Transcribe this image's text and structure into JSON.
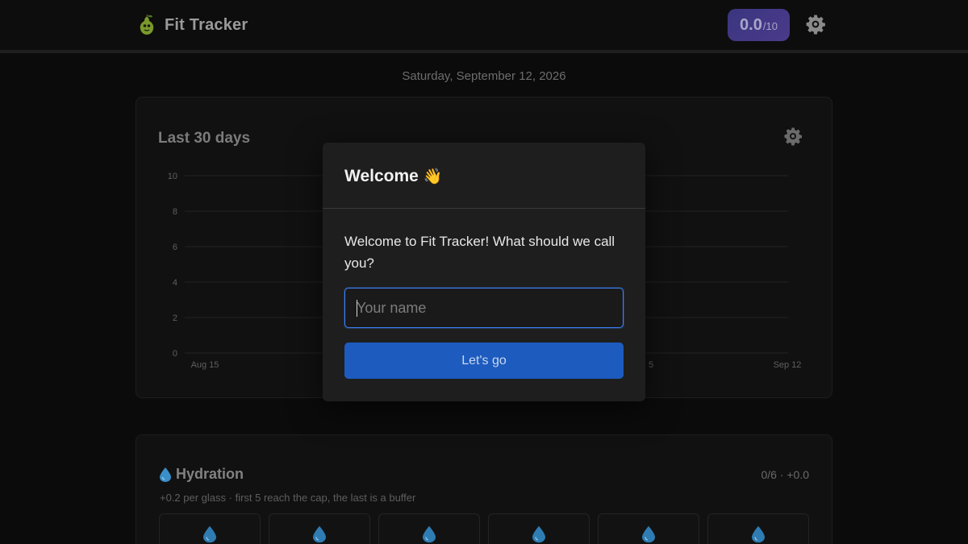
{
  "app": {
    "title": "Fit Tracker",
    "score": {
      "value": "0.0",
      "max": "/10"
    },
    "icons": {
      "logo": "pear-logo-icon",
      "settings": "gear-icon"
    }
  },
  "date": "Saturday, September 12, 2026",
  "chart_card": {
    "title": "Last 30 days",
    "settings_icon": "gear-icon"
  },
  "chart_data": {
    "type": "line",
    "title": "Last 30 days",
    "xlabel": "",
    "ylabel": "",
    "x_tick_labels": [
      "Aug 15",
      "5",
      "Sep 12"
    ],
    "y_ticks": [
      0,
      2,
      4,
      6,
      8,
      10
    ],
    "ylim": [
      0,
      10
    ],
    "grid": true,
    "series": []
  },
  "hydration": {
    "icon": "water-drop-icon",
    "title": "Hydration",
    "stats": "0/6 · +0.0",
    "subtitle": "+0.2 per glass · first 5 reach the cap, the last is a buffer",
    "glasses": [
      {
        "icon": "water-drop-icon"
      },
      {
        "icon": "water-drop-icon"
      },
      {
        "icon": "water-drop-icon"
      },
      {
        "icon": "water-drop-icon"
      },
      {
        "icon": "water-drop-icon"
      },
      {
        "icon": "water-drop-icon"
      }
    ]
  },
  "modal": {
    "title": "Welcome",
    "title_emoji": "👋",
    "message": "Welcome to Fit Tracker! What should we call you?",
    "input": {
      "value": "",
      "placeholder": "Your name"
    },
    "submit_label": "Let's go"
  },
  "colors": {
    "background": "#0b0b0b",
    "modal": "#1e1e1e",
    "accent_button": "#1d5bbf",
    "input_focus": "#3b82f6",
    "score_pill": "#3a3680"
  }
}
